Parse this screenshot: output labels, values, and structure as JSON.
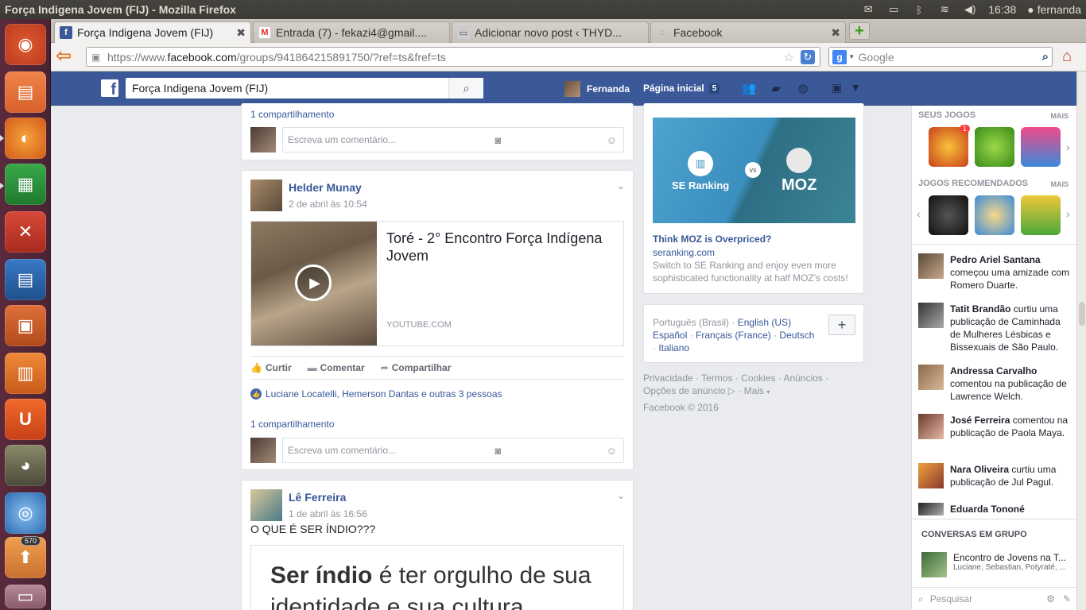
{
  "top_panel": {
    "window_title": "Força Indigena Jovem (FIJ) - Mozilla Firefox",
    "clock": "16:38",
    "user": "fernanda"
  },
  "launcher": {
    "badge": "570"
  },
  "tabs": [
    {
      "label": "Força Indigena Jovem (FIJ)",
      "icon": "facebook-icon"
    },
    {
      "label": "Entrada (7) - fekazi4@gmail....",
      "icon": "gmail-icon"
    },
    {
      "label": "Adicionar novo post ‹ THYD...",
      "icon": "wordpress-icon"
    },
    {
      "label": "Facebook",
      "icon": "loading-icon"
    }
  ],
  "nav": {
    "url_prefix": "https://www.",
    "url_domain": "facebook.com",
    "url_path": "/groups/941864215891750/?ref=ts&fref=ts",
    "search_placeholder": "Google"
  },
  "fb_header": {
    "search_value": "Força Indigena Jovem (FIJ)",
    "user_name": "Fernanda",
    "home_label": "Página inicial",
    "home_count": "5"
  },
  "feed": {
    "top_card": {
      "shares": "1 compartilhamento",
      "comment_placeholder": "Escreva um comentário..."
    },
    "post1": {
      "author": "Helder Munay",
      "time": "2 de abril às 10:54",
      "link_title": "Toré - 2° Encontro Força Indígena Jovem",
      "link_source": "YOUTUBE.COM",
      "like_label": "Curtir",
      "comment_label": "Comentar",
      "share_label": "Compartilhar",
      "likes_text": "Luciane Locatelli, Hemerson Dantas e outras 3 pessoas",
      "shares": "1 compartilhamento",
      "comment_placeholder": "Escreva um comentário..."
    },
    "post2": {
      "author": "Lê Ferreira",
      "time": "1 de abril às 16:56",
      "text": "O QUE É SER ÍNDIO???",
      "image_text_bold": "Ser índio",
      "image_text_rest": " é ter orgulho de sua identidade e sua cultura"
    }
  },
  "ad": {
    "img_left": "SE Ranking",
    "img_vs": "vs",
    "img_right": "MOZ",
    "title": "Think MOZ is Overpriced?",
    "domain": "seranking.com",
    "body": "Switch to SE Ranking and enjoy even more sophisticated functionality at half MOZ's costs!"
  },
  "languages": {
    "current": "Português (Brasil)",
    "options": [
      "English (US)",
      "Español",
      "Français (France)",
      "Deutsch",
      "Italiano"
    ]
  },
  "footer": {
    "links": [
      "Privacidade",
      "Termos",
      "Cookies",
      "Anúncios",
      "Opções de anúncio",
      "Mais"
    ],
    "copyright": "Facebook © 2016"
  },
  "sidebar": {
    "my_games_label": "SEUS JOGOS",
    "recommended_label": "JOGOS RECOMENDADOS",
    "more_label": "MAIS",
    "game_badge": "1",
    "ticker": [
      {
        "name": "Pedro Ariel Santana",
        "text": " começou uma amizade com Romero Duarte."
      },
      {
        "name": "Tatit Brandão",
        "text": " curtiu uma publicação de Caminhada de Mulheres Lésbicas e Bissexuais de São Paulo."
      },
      {
        "name": "Andressa Carvalho",
        "text": " comentou na publicação de Lawrence Welch."
      },
      {
        "name": "José Ferreira",
        "text": " comentou na publicação de Paola Maya."
      },
      {
        "name": "Nara Oliveira",
        "text": " curtiu uma publicação de Jul Pagul."
      },
      {
        "name": "Eduarda Tononé",
        "text": ""
      }
    ],
    "group_chats_label": "CONVERSAS EM GRUPO",
    "group_chat_title": "Encontro de Jovens na T...",
    "group_chat_members": "Luciane, Sebastian, Potyraté, ...",
    "chat_search_placeholder": "Pesquisar"
  },
  "colors": {
    "facebook_blue": "#3b5998",
    "link_blue": "#365899",
    "unity_launcher": "#5a2a3c",
    "ubuntu_panel": "#3b3a35"
  }
}
